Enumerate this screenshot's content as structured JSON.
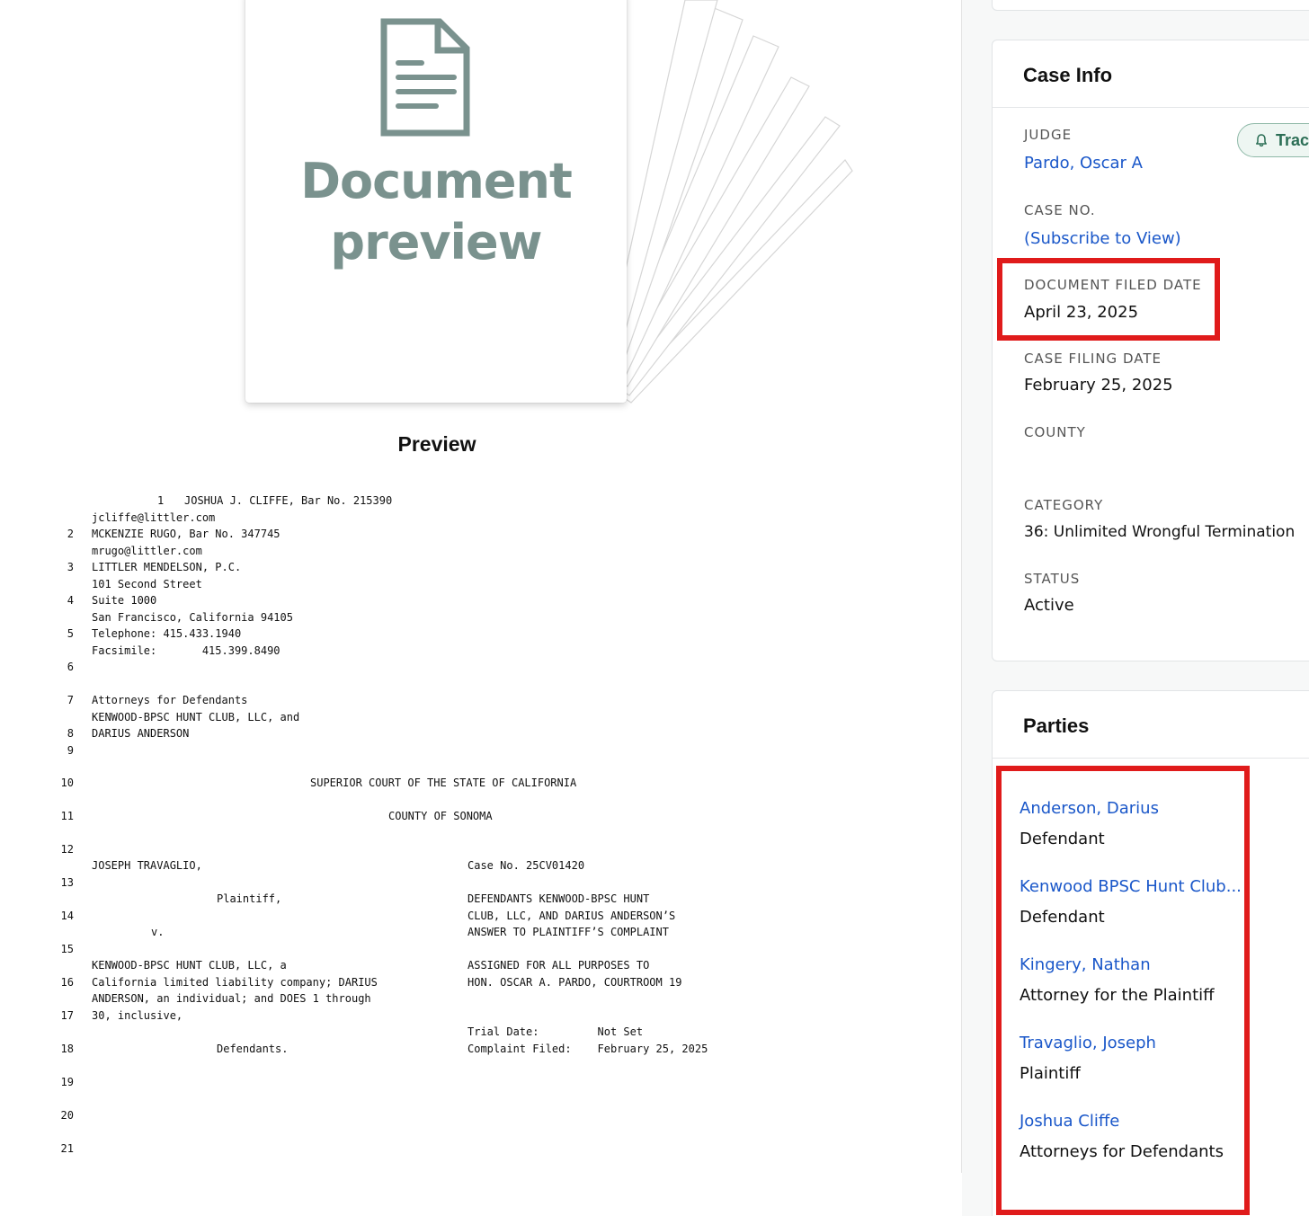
{
  "preview": {
    "placeholder_line1": "Document",
    "placeholder_line2": "preview",
    "label": "Preview",
    "icon": "document-icon"
  },
  "document_lines": [
    {
      "num": "1",
      "text": "JOSHUA J. CLIFFE, Bar No. 215390"
    },
    {
      "num": "",
      "text": "jcliffe@littler.com"
    },
    {
      "num": "2",
      "text": "MCKENZIE RUGO, Bar No. 347745"
    },
    {
      "num": "",
      "text": "mrugo@littler.com"
    },
    {
      "num": "3",
      "text": "LITTLER MENDELSON, P.C."
    },
    {
      "num": "",
      "text": "101 Second Street"
    },
    {
      "num": "4",
      "text": "Suite 1000"
    },
    {
      "num": "",
      "text": "San Francisco, California 94105"
    },
    {
      "num": "5",
      "text": "Telephone: 415.433.1940"
    },
    {
      "num": "",
      "text": "Facsimile:       415.399.8490"
    },
    {
      "num": "6",
      "text": ""
    },
    {
      "num": "7",
      "text": "Attorneys for Defendants"
    },
    {
      "num": "",
      "text": "KENWOOD-BPSC HUNT CLUB, LLC, and"
    },
    {
      "num": "8",
      "text": "DARIUS ANDERSON"
    },
    {
      "num": "9",
      "text": ""
    },
    {
      "num": "10",
      "text": "SUPERIOR COURT OF THE STATE OF CALIFORNIA"
    },
    {
      "num": "11",
      "text": "COUNTY OF SONOMA"
    },
    {
      "num": "12",
      "text": ""
    },
    {
      "num": "",
      "text": "JOSEPH TRAVAGLIO,"
    },
    {
      "num": "",
      "text": "Case No. 25CV01420"
    },
    {
      "num": "13",
      "text": ""
    },
    {
      "num": "",
      "text": "Plaintiff,"
    },
    {
      "num": "",
      "text": "DEFENDANTS KENWOOD-BPSC HUNT"
    },
    {
      "num": "14",
      "text": ""
    },
    {
      "num": "",
      "text": "CLUB, LLC, AND DARIUS ANDERSON’S"
    },
    {
      "num": "",
      "text": "v."
    },
    {
      "num": "",
      "text": "ANSWER TO PLAINTIFF’S COMPLAINT"
    },
    {
      "num": "15",
      "text": ""
    },
    {
      "num": "",
      "text": "KENWOOD-BPSC HUNT CLUB, LLC, a"
    },
    {
      "num": "",
      "text": "ASSIGNED FOR ALL PURPOSES TO"
    },
    {
      "num": "16",
      "text": "California limited liability company; DARIUS"
    },
    {
      "num": "",
      "text": "HON. OSCAR A. PARDO, COURTROOM 19"
    },
    {
      "num": "",
      "text": "ANDERSON, an individual; and DOES 1 through"
    },
    {
      "num": "17",
      "text": "30, inclusive,"
    },
    {
      "num": "",
      "text": "Trial Date:         Not Set"
    },
    {
      "num": "",
      "text": "Complaint Filed:    February 25, 2025"
    },
    {
      "num": "18",
      "text": "Defendants."
    },
    {
      "num": "19",
      "text": ""
    },
    {
      "num": "20",
      "text": ""
    },
    {
      "num": "21",
      "text": ""
    }
  ],
  "case_info": {
    "title": "Case Info",
    "track_label": "Trac",
    "judge_label": "JUDGE",
    "judge_value": "Pardo, Oscar A",
    "case_no_label": "CASE NO.",
    "case_no_value": "(Subscribe to View)",
    "doc_filed_label": "DOCUMENT FILED DATE",
    "doc_filed_value": "April 23, 2025",
    "case_filing_label": "CASE FILING DATE",
    "case_filing_value": "February 25, 2025",
    "county_label": "COUNTY",
    "county_value": "",
    "category_label": "CATEGORY",
    "category_value": "36: Unlimited Wrongful Termination",
    "status_label": "STATUS",
    "status_value": "Active"
  },
  "parties": {
    "title": "Parties",
    "items": [
      {
        "name": "Anderson, Darius",
        "role": "Defendant"
      },
      {
        "name": "Kenwood BPSC Hunt Club...",
        "role": "Defendant"
      },
      {
        "name": "Kingery, Nathan",
        "role": "Attorney for the Plaintiff"
      },
      {
        "name": "Travaglio, Joseph",
        "role": "Plaintiff"
      },
      {
        "name": "Joshua Cliffe",
        "role": "Attorneys for Defendants"
      }
    ]
  },
  "colors": {
    "link": "#1a57c9",
    "highlight": "#e01b1b",
    "preview_gray": "#7a928e",
    "track_green": "#2b6e55"
  }
}
